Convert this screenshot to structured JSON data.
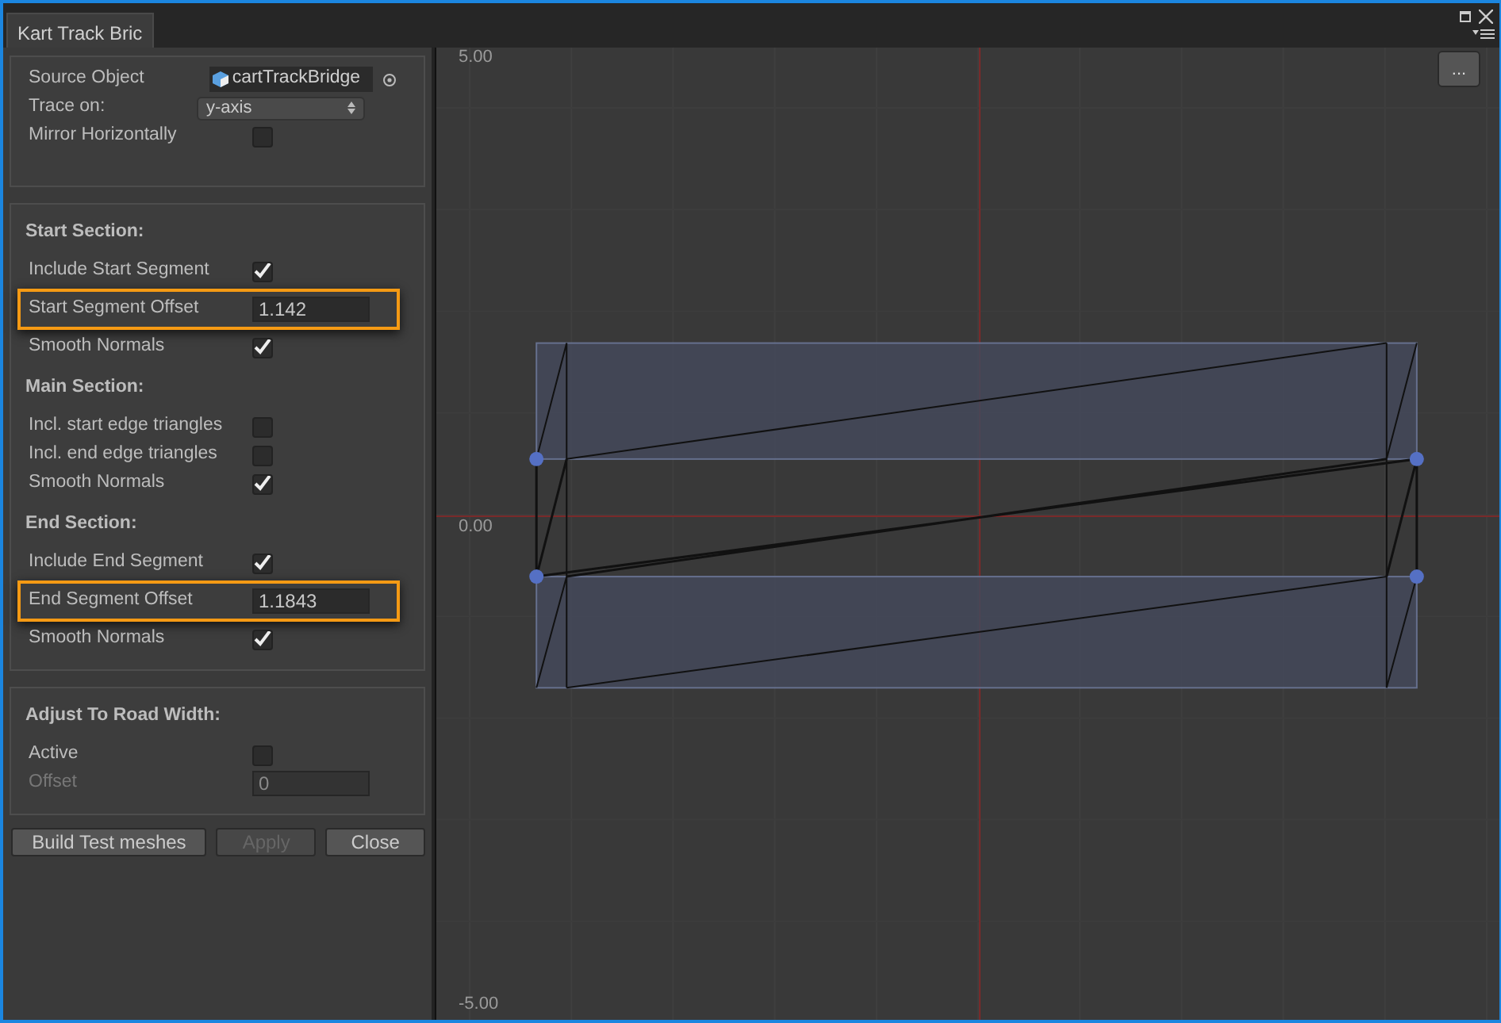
{
  "tab": {
    "label": "Kart Track Bric"
  },
  "general": {
    "rows": [
      {
        "kind": "object",
        "label": "Source Object",
        "value": "cartTrackBridge"
      },
      {
        "kind": "dropdown",
        "label": "Trace on:",
        "value": "y-axis"
      },
      {
        "kind": "checkbox",
        "label": "Mirror Horizontally",
        "checked": false
      }
    ]
  },
  "section_panels": [
    {
      "sections": [
        {
          "title": "Start Section:",
          "rows": [
            {
              "kind": "checkbox",
              "label": "Include Start Segment",
              "checked": true,
              "highlighted": false,
              "disabled": false
            },
            {
              "kind": "number",
              "label": "Start Segment Offset",
              "value": "1.142",
              "highlighted": true,
              "disabled": false
            },
            {
              "kind": "checkbox",
              "label": "Smooth Normals",
              "checked": true,
              "highlighted": false,
              "disabled": false
            }
          ]
        },
        {
          "title": "Main Section:",
          "rows": [
            {
              "kind": "checkbox",
              "label": "Incl. start edge triangles",
              "checked": false,
              "highlighted": false,
              "disabled": false
            },
            {
              "kind": "checkbox",
              "label": "Incl. end edge triangles",
              "checked": false,
              "highlighted": false,
              "disabled": false
            },
            {
              "kind": "checkbox",
              "label": "Smooth Normals",
              "checked": true,
              "highlighted": false,
              "disabled": false
            }
          ]
        },
        {
          "title": "End Section:",
          "rows": [
            {
              "kind": "checkbox",
              "label": "Include End Segment",
              "checked": true,
              "highlighted": false,
              "disabled": false
            },
            {
              "kind": "number",
              "label": "End Segment Offset",
              "value": "1.1843",
              "highlighted": true,
              "disabled": false
            },
            {
              "kind": "checkbox",
              "label": "Smooth Normals",
              "checked": true,
              "highlighted": false,
              "disabled": false
            }
          ]
        }
      ]
    },
    {
      "sections": [
        {
          "title": "Adjust To Road Width:",
          "rows": [
            {
              "kind": "checkbox",
              "label": "Active",
              "checked": false,
              "highlighted": false,
              "disabled": false
            },
            {
              "kind": "number",
              "label": "Offset",
              "value": "0",
              "highlighted": false,
              "disabled": true
            }
          ]
        }
      ]
    }
  ],
  "buttons": [
    {
      "label": "Build Test meshes",
      "disabled": false
    },
    {
      "label": "Apply",
      "disabled": true
    },
    {
      "label": "Close",
      "disabled": false
    }
  ],
  "canvas": {
    "more_button": {
      "label": "..."
    },
    "axis_labels": [
      "5.00",
      "0.00",
      "-5.00"
    ]
  }
}
